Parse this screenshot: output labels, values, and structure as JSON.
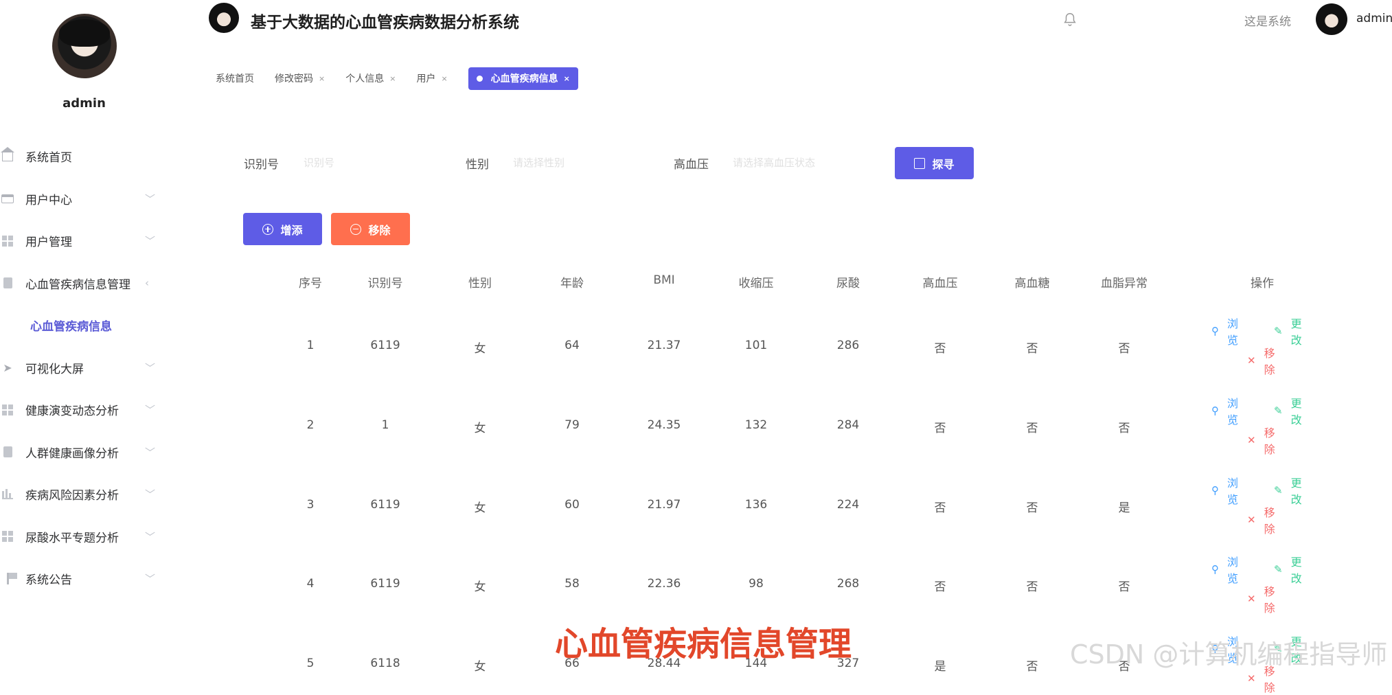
{
  "app": {
    "title": "基于大数据的心血管疾病数据分析系统",
    "system_link": "这是系统",
    "user": "admin"
  },
  "sidebar": {
    "username": "admin",
    "items": [
      {
        "label": "系统首页",
        "icon": "home-icon"
      },
      {
        "label": "用户中心",
        "icon": "card-icon",
        "arrow": "chevron-down-icon"
      },
      {
        "label": "用户管理",
        "icon": "grid-icon",
        "arrow": "chevron-down-icon"
      },
      {
        "label": "心血管疾病信息管理",
        "icon": "clipboard-icon",
        "arrow": "chevron-left-icon"
      },
      {
        "label": "心血管疾病信息",
        "sub": true
      },
      {
        "label": "可视化大屏",
        "icon": "send-icon",
        "arrow": "chevron-down-icon"
      },
      {
        "label": "健康演变动态分析",
        "icon": "grid-icon",
        "arrow": "chevron-down-icon"
      },
      {
        "label": "人群健康画像分析",
        "icon": "check-clipboard-icon",
        "arrow": "chevron-down-icon"
      },
      {
        "label": "疾病风险因素分析",
        "icon": "bar-chart-icon",
        "arrow": "chevron-down-icon"
      },
      {
        "label": "尿酸水平专题分析",
        "icon": "grid-icon",
        "arrow": "chevron-down-icon"
      },
      {
        "label": "系统公告",
        "icon": "flag-icon",
        "arrow": "chevron-down-icon"
      }
    ]
  },
  "tabs": [
    {
      "label": "系统首页"
    },
    {
      "label": "修改密码",
      "closable": true
    },
    {
      "label": "个人信息",
      "closable": true
    },
    {
      "label": "用户",
      "closable": true
    },
    {
      "label": "心血管疾病信息",
      "closable": true,
      "active": true
    }
  ],
  "search": {
    "id_label": "识别号",
    "id_placeholder": "识别号",
    "gender_label": "性别",
    "gender_placeholder": "请选择性别",
    "hypertension_label": "高血压",
    "hypertension_placeholder": "请选择高血压状态",
    "button": "探寻"
  },
  "actions": {
    "add": "增添",
    "remove": "移除"
  },
  "table": {
    "headers": [
      "序号",
      "识别号",
      "性别",
      "年龄",
      "BMI",
      "收缩压",
      "尿酸",
      "高血压",
      "高血糖",
      "血脂异常",
      "操作"
    ],
    "row_actions": {
      "view": "浏览",
      "edit": "更改",
      "delete": "移除"
    },
    "rows": [
      [
        "1",
        "6119",
        "女",
        "64",
        "21.37",
        "101",
        "286",
        "否",
        "否",
        "否"
      ],
      [
        "2",
        "1",
        "女",
        "79",
        "24.35",
        "132",
        "284",
        "否",
        "否",
        "否"
      ],
      [
        "3",
        "6119",
        "女",
        "60",
        "21.97",
        "136",
        "224",
        "否",
        "否",
        "是"
      ],
      [
        "4",
        "6119",
        "女",
        "58",
        "22.36",
        "98",
        "268",
        "否",
        "否",
        "否"
      ],
      [
        "5",
        "6118",
        "女",
        "66",
        "28.44",
        "144",
        "327",
        "是",
        "否",
        "否"
      ]
    ]
  },
  "overlay": {
    "caption": "心血管疾病信息管理",
    "watermark": "CSDN @计算机编程指导师"
  },
  "colors": {
    "primary": "#5e5ce6",
    "danger": "#ff6f4e",
    "view": "#409eff",
    "edit": "#3ccf97",
    "delete": "#f56c6c"
  }
}
